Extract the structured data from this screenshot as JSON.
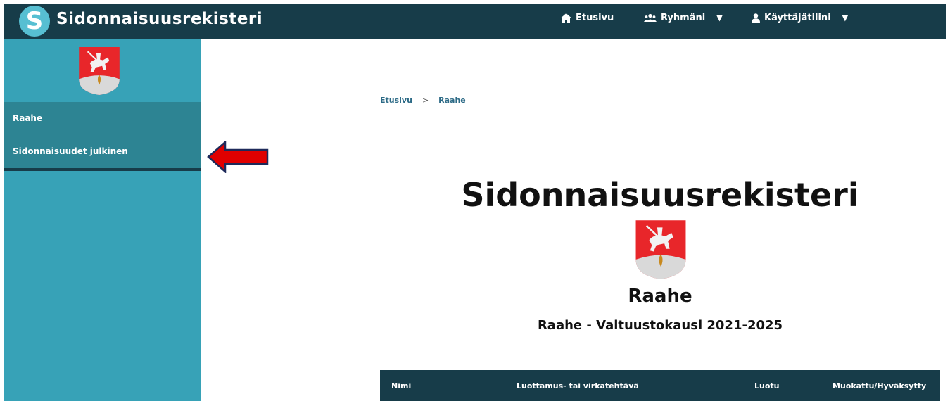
{
  "header": {
    "logo_letter": "S",
    "app_title": "Sidonnaisuusrekisteri",
    "nav": {
      "home_label": "Etusivu",
      "groups_label": "Ryhmäni",
      "account_label": "Käyttäjätilini",
      "dropdown_caret": "▼"
    }
  },
  "sidebar": {
    "items": [
      {
        "label": "Raahe"
      },
      {
        "label": "Sidonnaisuudet julkinen"
      }
    ]
  },
  "breadcrumb": {
    "items": [
      "Etusivu",
      "Raahe"
    ],
    "separator": ">"
  },
  "main": {
    "title": "Sidonnaisuusrekisteri",
    "municipality": "Raahe",
    "period": "Raahe - Valtuustokausi 2021-2025"
  },
  "table": {
    "columns": [
      "Nimi",
      "Luottamus- tai virkatehtävä",
      "Luotu",
      "Muokattu/Hyväksytty"
    ]
  },
  "colors": {
    "header_bg": "#173c49",
    "sidebar_bg": "#37a2b7",
    "sidebar_menu_bg": "#2d8493",
    "logo": "#57bfd2",
    "crest_red": "#e8262a",
    "annotation_arrow": "#e00000"
  },
  "icons": [
    "home-icon",
    "users-icon",
    "user-icon",
    "coat-of-arms",
    "red-arrow-annotation"
  ]
}
